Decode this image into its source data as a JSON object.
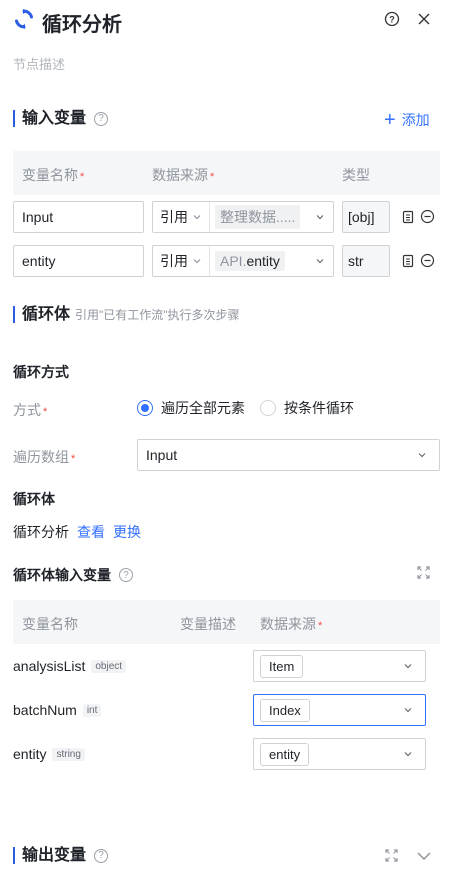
{
  "header": {
    "title": "循环分析",
    "description": "节点描述"
  },
  "input_vars": {
    "title": "输入变量",
    "add_label": "添加",
    "columns": {
      "name": "变量名称",
      "source": "数据来源",
      "type": "类型"
    },
    "rows": [
      {
        "name": "Input",
        "source_mode": "引用",
        "source_value": "整理数据.....",
        "source_value_prefix": "",
        "type": "[obj]"
      },
      {
        "name": "entity",
        "source_mode": "引用",
        "source_value": "entity",
        "source_value_prefix": "API.",
        "type": "str"
      }
    ]
  },
  "loop_body": {
    "title": "循环体",
    "subtitle": "引用\"已有工作流\"执行多次步骤",
    "mode_section": "循环方式",
    "mode_label": "方式",
    "mode_options": [
      "遍历全部元素",
      "按条件循环"
    ],
    "mode_selected": 0,
    "array_label": "遍历数组",
    "array_value": "Input",
    "body_section": "循环体",
    "body_name": "循环分析",
    "view_link": "查看",
    "replace_link": "更换",
    "body_inputs_title": "循环体输入变量",
    "body_columns": {
      "name": "变量名称",
      "desc": "变量描述",
      "source": "数据来源"
    },
    "body_rows": [
      {
        "name": "analysisList",
        "type": "object",
        "source": "Item"
      },
      {
        "name": "batchNum",
        "type": "int",
        "source": "Index"
      },
      {
        "name": "entity",
        "type": "string",
        "source": "entity"
      }
    ]
  },
  "output_vars": {
    "title": "输出变量"
  },
  "colors": {
    "accent": "#3370ff",
    "required": "#f54a45",
    "border": "#d0d3d6"
  }
}
